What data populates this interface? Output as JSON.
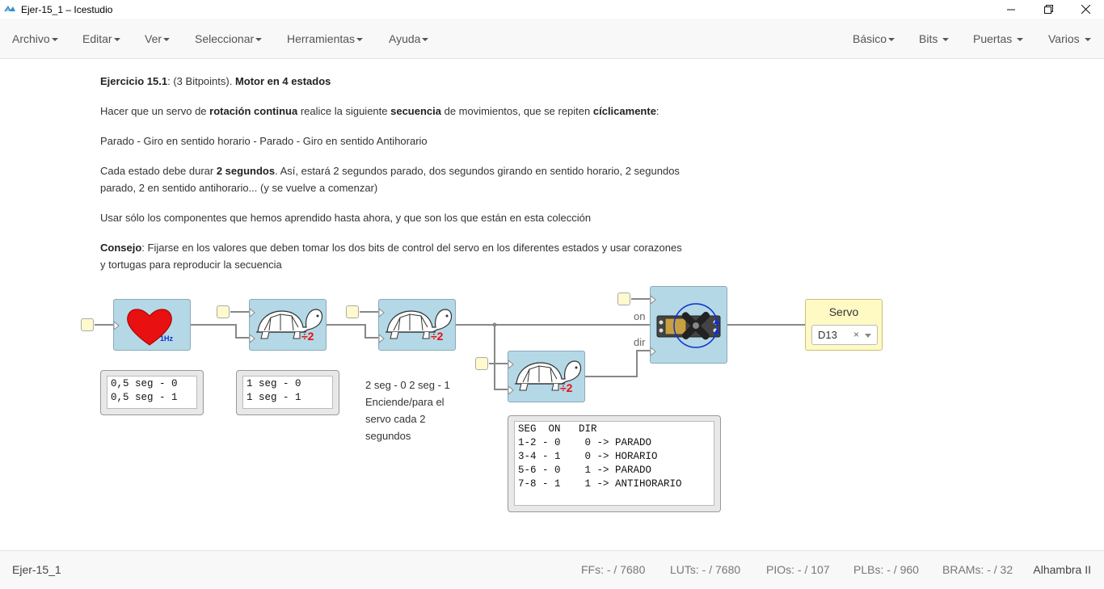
{
  "window": {
    "title": "Ejer-15_1 – Icestudio"
  },
  "menu": {
    "left": [
      "Archivo",
      "Editar",
      "Ver",
      "Seleccionar",
      "Herramientas",
      "Ayuda"
    ],
    "right": [
      "Básico",
      "Bits",
      "Puertas",
      "Varios"
    ]
  },
  "description": {
    "p1_title": "Ejercicio 15.1",
    "p1_mid": ": (3 Bitpoints). ",
    "p1_bold": "Motor en 4 estados",
    "p2_a": "Hacer que un servo de ",
    "p2_b": "rotación continua",
    "p2_c": " realice la siguiente ",
    "p2_d": "secuencia",
    "p2_e": " de movimientos, que se repiten ",
    "p2_f": "cíclicamente",
    "p2_g": ":",
    "p3": "Parado - Giro en sentido horario - Parado - Giro en sentido Antihorario",
    "p4_a": "Cada estado debe durar ",
    "p4_b": "2 segundos",
    "p4_c": ". Así, estará 2 segundos parado, dos segundos girando en sentido horario, 2 segundos parado, 2 en sentido antihorario... (y se vuelve a comenzar)",
    "p5": "Usar sólo los componentes que hemos aprendido hasta ahora, y que son los que están en esta colección",
    "p6_a": "Consejo",
    "p6_b": ": Fijarse en los valores que deben tomar los dos bits de control del servo en los diferentes estados y usar corazones y tortugas para reproducir la secuencia"
  },
  "circuit": {
    "heart_label": "1Hz",
    "divider_label": "÷2",
    "servo_ports": {
      "on": "on",
      "dir": "dir"
    },
    "output": {
      "label": "Servo",
      "pin": "D13",
      "clear": "×"
    },
    "memo1": "0,5 seg - 0\n0,5 seg - 1",
    "memo2": "1 seg - 0\n1 seg - 1",
    "note": "2 seg - 0 2 seg - 1 Enciende/para el servo cada 2 segundos",
    "table": "SEG  ON   DIR\n1-2 - 0    0 -> PARADO\n3-4 - 1    0 -> HORARIO\n5-6 - 0    1 -> PARADO\n7-8 - 1    1 -> ANTIHORARIO"
  },
  "footer": {
    "project": "Ejer-15_1",
    "ffs": "FFs:  - / 7680",
    "luts": "LUTs:  - / 7680",
    "pios": "PIOs:  - / 107",
    "plbs": "PLBs:  - / 960",
    "brams": "BRAMs:  - / 32",
    "board": "Alhambra II"
  },
  "colors": {
    "block": "#b4d8e6",
    "input_port": "#fffacd",
    "output_block": "#fff9c4",
    "heart": "#e81010"
  }
}
